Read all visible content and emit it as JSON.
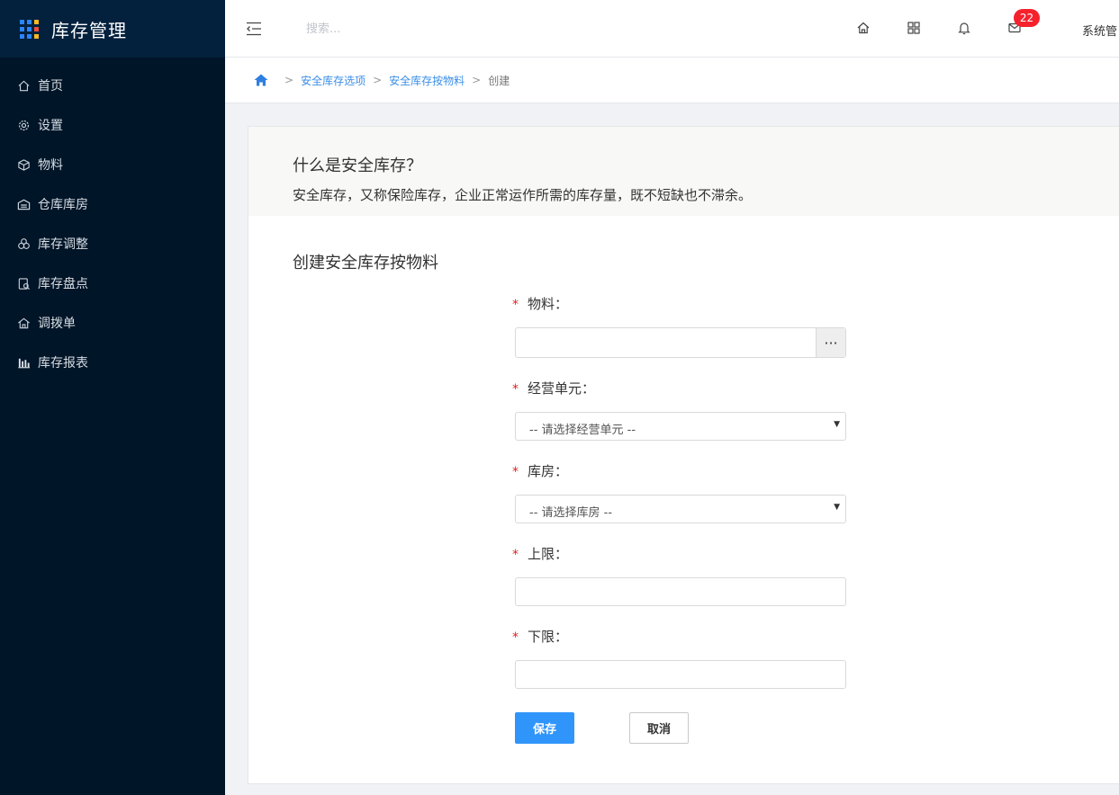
{
  "brand": {
    "title": "库存管理",
    "icon": "grid-icon"
  },
  "sidebar": {
    "items": [
      {
        "label": "首页",
        "icon": "home-icon"
      },
      {
        "label": "设置",
        "icon": "gear-icon"
      },
      {
        "label": "物料",
        "icon": "box-icon"
      },
      {
        "label": "仓库库房",
        "icon": "warehouse-icon"
      },
      {
        "label": "库存调整",
        "icon": "adjust-icon"
      },
      {
        "label": "库存盘点",
        "icon": "inventory-check-icon"
      },
      {
        "label": "调拨单",
        "icon": "transfer-icon"
      },
      {
        "label": "库存报表",
        "icon": "bar-chart-icon"
      }
    ]
  },
  "header": {
    "search_placeholder": "搜索...",
    "mail_badge": "22",
    "user": "系统管",
    "icons": [
      "menu-fold-icon",
      "home-icon",
      "apps-icon",
      "bell-icon",
      "mail-icon"
    ]
  },
  "breadcrumb": {
    "sep": ">",
    "items": [
      "安全库存选项",
      "安全库存按物料"
    ],
    "current": "创建"
  },
  "intro": {
    "title": "什么是安全库存？",
    "text": "安全库存，又称保险库存，企业正常运作所需的库存量，既不短缺也不滞余。"
  },
  "form": {
    "title": "创建安全库存按物料",
    "required_mark": "*",
    "fields": {
      "material": {
        "label": "物料：",
        "value": "",
        "picker": "···"
      },
      "business_unit": {
        "label": "经营单元：",
        "selected": "-- 请选择经营单元 --"
      },
      "warehouse": {
        "label": "库房：",
        "selected": "-- 请选择库房 --"
      },
      "upper": {
        "label": "上限：",
        "value": ""
      },
      "lower": {
        "label": "下限：",
        "value": ""
      }
    },
    "save": "保存",
    "cancel": "取消"
  },
  "colors": {
    "sidebar_bg": "#011528",
    "brand_bg": "#03213d",
    "primary": "#2f95fb",
    "badge": "#f5222d",
    "required": "#e02020"
  }
}
